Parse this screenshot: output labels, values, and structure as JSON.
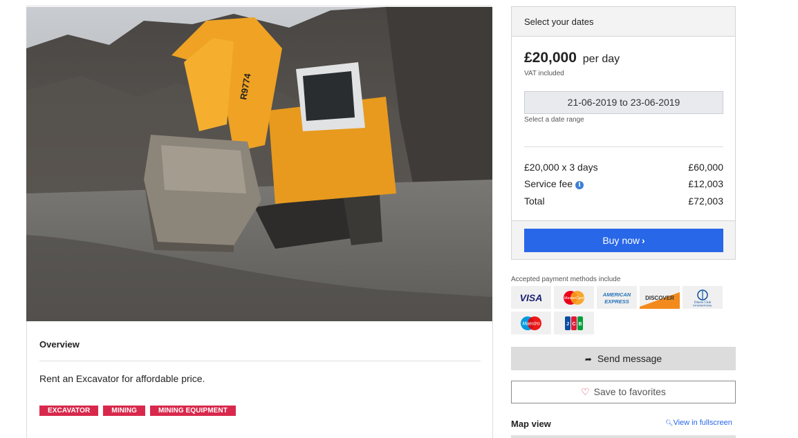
{
  "listing": {
    "overview_title": "Overview",
    "description": "Rent an Excavator for affordable price.",
    "tags": [
      "EXCAVATOR",
      "MINING",
      "MINING EQUIPMENT"
    ],
    "machine_marking": "R9774"
  },
  "booking": {
    "header": "Select your dates",
    "price": "£20,000",
    "price_unit": "per day",
    "vat_note": "VAT included",
    "date_range_value": "21-06-2019 to 23-06-2019",
    "date_hint": "Select a date range",
    "lines": {
      "subtotal_label": "£20,000 x 3 days",
      "subtotal_value": "£60,000",
      "fee_label": "Service fee",
      "fee_value": "£12,003",
      "total_label": "Total",
      "total_value": "£72,003"
    },
    "buy_label": "Buy now",
    "buy_color": "#2867e8"
  },
  "payment": {
    "label": "Accepted payment methods include",
    "methods": [
      "VISA",
      "MasterCard",
      "AMERICAN EXPRESS",
      "DISCOVER",
      "Diners Club INTERNATIONAL",
      "Maestro",
      "JCB"
    ]
  },
  "actions": {
    "send_message": "Send message",
    "save_favorites": "Save to favorites"
  },
  "map": {
    "title": "Map view",
    "fullscreen_link": "View in fullscreen"
  },
  "colors": {
    "tag": "#d8294c",
    "accent": "#2867e8",
    "excavator": "#e89a1e"
  }
}
